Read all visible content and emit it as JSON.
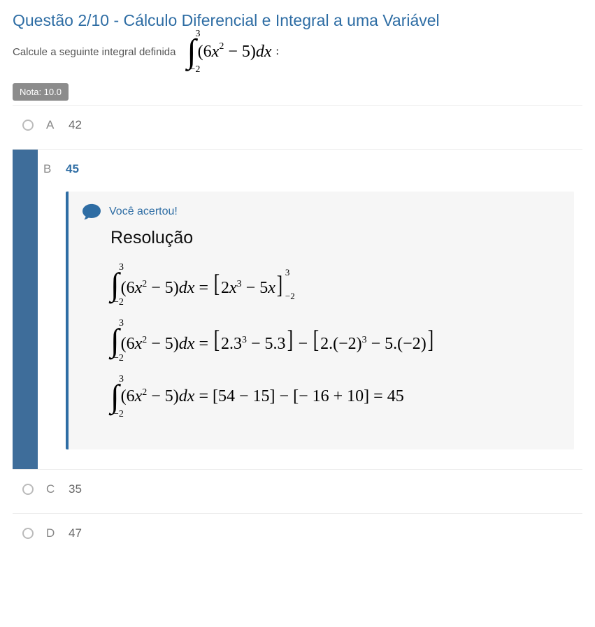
{
  "heading": "Questão 2/10 - Cálculo Diferencial e Integral a uma Variável",
  "prompt_text": "Calcule a seguinte integral definida",
  "integral": {
    "upper": "3",
    "lower": "−2",
    "expr_open": "(",
    "expr_a": "6",
    "expr_var": "x",
    "expr_pow": "2",
    "expr_mid": " − 5)",
    "expr_dx": "dx",
    "colon": ":"
  },
  "nota_label": "Nota: 10.0",
  "options": {
    "a": {
      "letter": "A",
      "value": "42"
    },
    "b": {
      "letter": "B",
      "value": "45"
    },
    "c": {
      "letter": "C",
      "value": "35"
    },
    "d": {
      "letter": "D",
      "value": "47"
    }
  },
  "feedback": {
    "you_got_it": "Você acertou!",
    "res_title": "Resolução"
  },
  "solution": {
    "line1": {
      "eq": " = ",
      "r1a": "2",
      "r1var": "x",
      "r1pow": "3",
      "r1mid": " − 5",
      "r1var2": "x",
      "eval_up": "3",
      "eval_lo": "−2"
    },
    "line2": {
      "eq": " = ",
      "a1": "2.3",
      "a1p": "3",
      "a1mid": " − 5.3",
      "minus": " − ",
      "b1": "2.(−2)",
      "b1p": "3",
      "b1mid": " − 5.(−2)"
    },
    "line3": {
      "eq": " = ",
      "l1": "[54 − 15]",
      "minus": " − ",
      "l2": "[− 16 + 10]",
      "eq2": " = ",
      "ans": "45"
    }
  }
}
